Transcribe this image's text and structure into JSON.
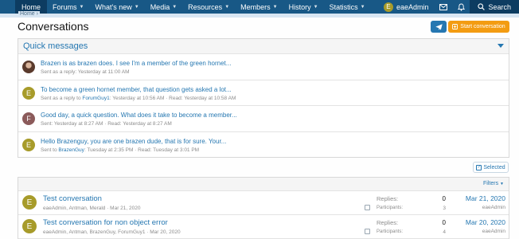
{
  "nav": {
    "items": [
      {
        "label": "Home",
        "caret": false
      },
      {
        "label": "Forums",
        "caret": true
      },
      {
        "label": "What's new",
        "caret": true
      },
      {
        "label": "Media",
        "caret": true
      },
      {
        "label": "Resources",
        "caret": true
      },
      {
        "label": "Members",
        "caret": true
      },
      {
        "label": "History",
        "caret": true
      },
      {
        "label": "Statistics",
        "caret": true
      }
    ],
    "user": {
      "initial": "E",
      "name": "eaeAdmin"
    },
    "search_label": "Search"
  },
  "breadcrumb": "Home",
  "page": {
    "title": "Conversations",
    "start_conversation_label": "Start conversation"
  },
  "quick_messages": {
    "title": "Quick messages",
    "rows": [
      {
        "avatar_initial": "",
        "avatar_color": "#6b4a3a",
        "subject": "Brazen is as brazen does. I see I'm a member of the green hornet...",
        "meta_pre": "Sent as a reply: Yesterday at 11:00 AM",
        "meta_user": "",
        "meta_post": ""
      },
      {
        "avatar_initial": "E",
        "avatar_color": "#a79b2a",
        "subject": "To become a green hornet member, that question gets asked a lot...",
        "meta_pre": "Sent as a reply to ",
        "meta_user": "ForumGuy1",
        "meta_post": ": Yesterday at 10:56 AM · Read: Yesterday at 10:58 AM"
      },
      {
        "avatar_initial": "F",
        "avatar_color": "#8b5a5a",
        "subject": "Good day, a quick question. What does it take to become a member...",
        "meta_pre": "Sent: Yesterday at 8:27 AM · Read: Yesterday at 8:27 AM",
        "meta_user": "",
        "meta_post": ""
      },
      {
        "avatar_initial": "E",
        "avatar_color": "#a79b2a",
        "subject": "Hello Brazenguy, you are one brazen dude, that is for sure. Your...",
        "meta_pre": "Sent to ",
        "meta_user": "BrazenGuy",
        "meta_post": ": Tuesday at 2:35 PM · Read: Tuesday at 3:01 PM"
      }
    ]
  },
  "toolbar": {
    "selected_label": "Selected",
    "filters_label": "Filters"
  },
  "conversations": [
    {
      "initial": "E",
      "title": "Test conversation",
      "participants_list": "eaeAdmin, Antman, Merald · Mar 21, 2020",
      "replies_label": "Replies:",
      "replies": "0",
      "participants_label": "Participants:",
      "participants": "3",
      "date": "Mar 21, 2020",
      "last_user": "eaeAdmin"
    },
    {
      "initial": "E",
      "title": "Test conversation for non object error",
      "participants_list": "eaeAdmin, Antman, BrazenGuy, ForumGuy1 · Mar 20, 2020",
      "replies_label": "Replies:",
      "replies": "0",
      "participants_label": "Participants:",
      "participants": "4",
      "date": "Mar 20, 2020",
      "last_user": "eaeAdmin"
    }
  ],
  "icons": {
    "user_avatar": "user-avatar",
    "mail": "envelope-icon",
    "bell": "bell-icon",
    "search": "search-icon",
    "send": "paper-plane-icon",
    "plus": "plus-icon"
  },
  "colors": {
    "nav_bg": "#185886",
    "link": "#2577b1",
    "accent": "#f39c12"
  }
}
